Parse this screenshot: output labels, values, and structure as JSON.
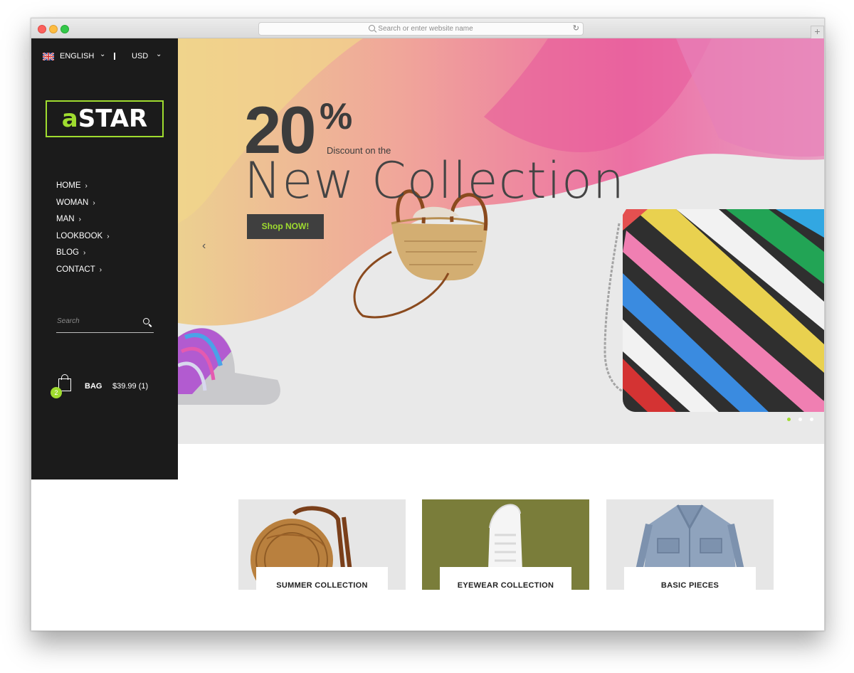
{
  "browser": {
    "url_placeholder": "Search or enter website name",
    "reload_icon": "reload-icon",
    "new_tab_icon": "plus-icon"
  },
  "colors": {
    "accent": "#9fdc2f",
    "sidebar_bg": "#1b1b1b",
    "button_bg": "#3f3f3f"
  },
  "sidebar": {
    "language": "ENGLISH",
    "currency": "USD",
    "logo_accent": "a",
    "logo_text": "STAR",
    "nav": [
      {
        "label": "HOME"
      },
      {
        "label": "WOMAN"
      },
      {
        "label": "MAN"
      },
      {
        "label": "LOOKBOOK"
      },
      {
        "label": "BLOG"
      },
      {
        "label": "CONTACT"
      }
    ],
    "search_placeholder": "Search",
    "bag_count": "2",
    "bag_label": "BAG",
    "bag_total": "$39.99 (1)"
  },
  "hero": {
    "percent_number": "20",
    "percent_sign": "%",
    "discount_text": "Discount on the",
    "title": "New Collection",
    "button_label": "Shop NOW!",
    "prev_arrow": "‹",
    "slides_total": 3,
    "active_slide": 1
  },
  "collections": [
    {
      "label": "SUMMER COLLECTION"
    },
    {
      "label": "EYEWEAR COLLECTION"
    },
    {
      "label": "BASIC PIECES"
    }
  ]
}
